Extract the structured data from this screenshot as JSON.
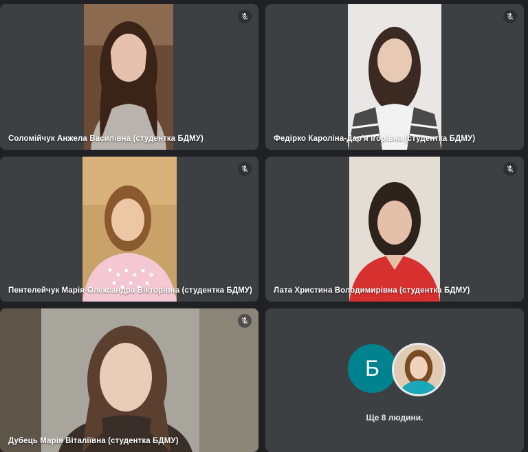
{
  "participants": [
    {
      "name": "Соломійчук Анжела Василівна (студентка БДМУ)",
      "muted": true
    },
    {
      "name": "Федірко Кароліна-Дар'я Ігорівна (студентка БДМУ)",
      "muted": true
    },
    {
      "name": "Пентелейчук Марія-Олександра Вікторівна (студентка БДМУ)",
      "muted": true
    },
    {
      "name": "Лата Христина Володимирівна (студентка БДМУ)",
      "muted": true
    },
    {
      "name": "Дубець Марія Віталіївна (студентка БДМУ)",
      "muted": true
    }
  ],
  "others": {
    "avatar_letter": "Б",
    "avatar_color": "#00838f",
    "count_text": "Ще 8 людини."
  },
  "colors": {
    "background": "#202124",
    "tile": "#3c4043"
  },
  "icons": {
    "mute": "mic-off-icon"
  }
}
